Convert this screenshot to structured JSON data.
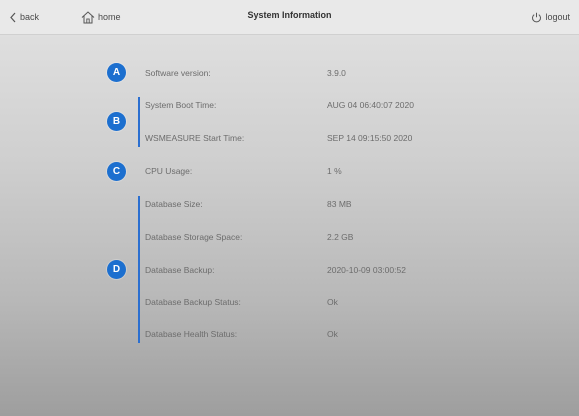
{
  "header": {
    "back_label": "back",
    "home_label": "home",
    "title": "System Information",
    "logout_label": "logout"
  },
  "badges": [
    "A",
    "B",
    "C",
    "D"
  ],
  "rows": [
    {
      "label": "Software version:",
      "value": "3.9.0"
    },
    {
      "label": "System Boot Time:",
      "value": "AUG 04 06:40:07 2020"
    },
    {
      "label": "WSMEASURE Start Time:",
      "value": "SEP 14 09:15:50 2020"
    },
    {
      "label": "CPU Usage:",
      "value": "1 %"
    },
    {
      "label": "Database Size:",
      "value": "83 MB"
    },
    {
      "label": "Database Storage Space:",
      "value": "2.2 GB"
    },
    {
      "label": "Database Backup:",
      "value": "2020-10-09 03:00:52"
    },
    {
      "label": "Database Backup Status:",
      "value": "Ok"
    },
    {
      "label": "Database Health Status:",
      "value": "Ok"
    }
  ],
  "colors": {
    "badge_blue": "#1c6fcf",
    "bracket_blue": "#2b6fd0"
  }
}
